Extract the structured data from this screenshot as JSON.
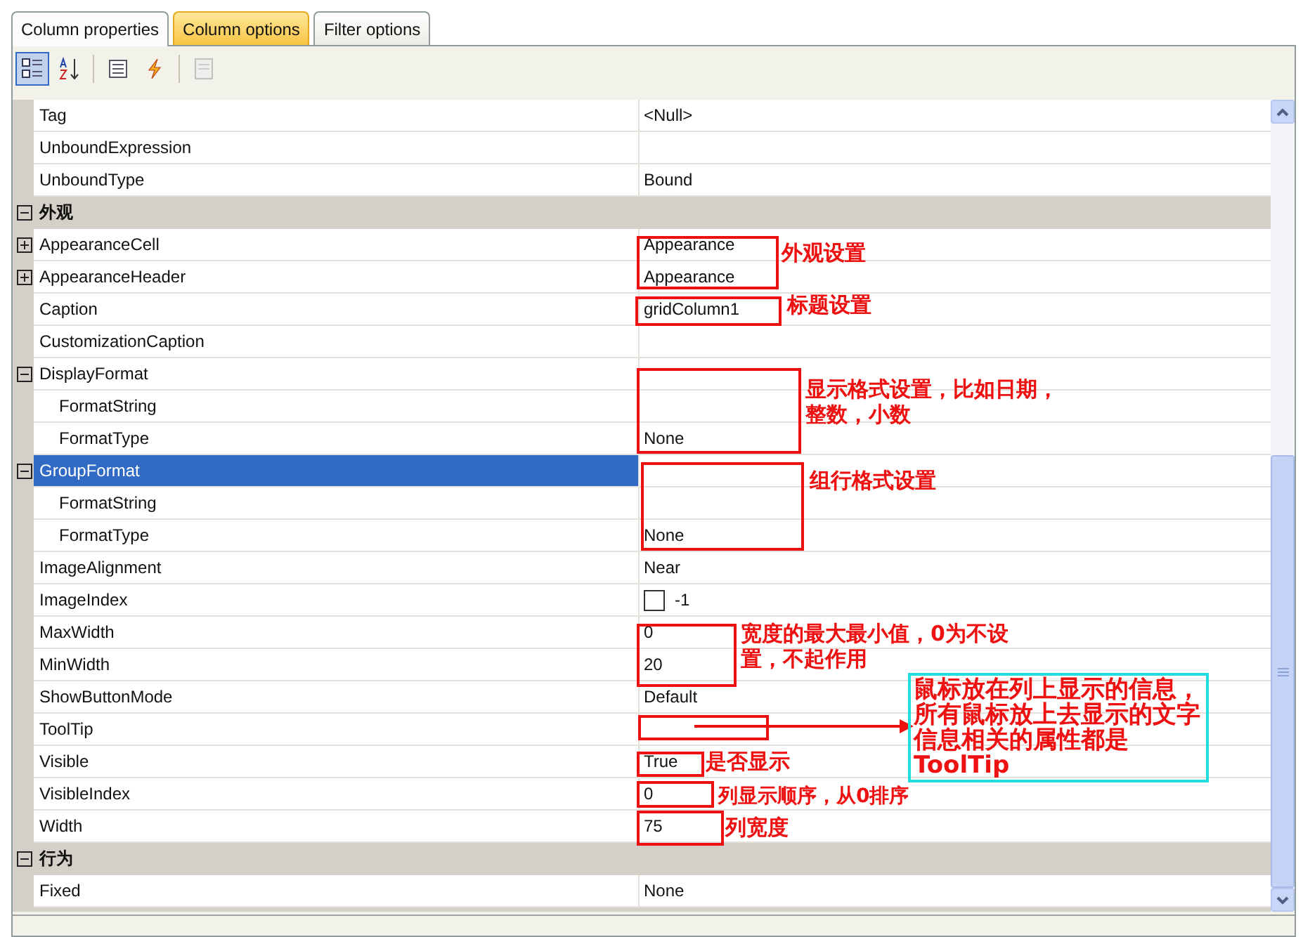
{
  "tabs": [
    {
      "label": "Column properties",
      "selected": true,
      "hot": false
    },
    {
      "label": "Column options",
      "selected": false,
      "hot": true
    },
    {
      "label": "Filter options",
      "selected": false,
      "hot": false
    }
  ],
  "toolbar": [
    {
      "kind": "categorized",
      "selected": true,
      "disabled": false
    },
    {
      "kind": "alphabetical",
      "selected": false,
      "disabled": false
    },
    {
      "kind": "properties",
      "selected": false,
      "disabled": false
    },
    {
      "kind": "events",
      "selected": false,
      "disabled": false
    },
    {
      "kind": "pages",
      "selected": false,
      "disabled": true
    }
  ],
  "rows": [
    {
      "kind": "property",
      "name": "Tag",
      "value": "<Null>",
      "selected": false
    },
    {
      "kind": "property",
      "name": "UnboundExpression",
      "selected": false
    },
    {
      "kind": "property",
      "name": "UnboundType",
      "value": "Bound",
      "selected": false
    },
    {
      "kind": "category",
      "name": "外观",
      "expanded": true,
      "selected": false,
      "children": [
        {
          "kind": "property",
          "name": "AppearanceCell",
          "value": "Appearance",
          "expanded": false,
          "selected": false
        },
        {
          "kind": "property",
          "name": "AppearanceHeader",
          "value": "Appearance",
          "expanded": false,
          "selected": false
        },
        {
          "kind": "property",
          "name": "Caption",
          "value": "gridColumn1",
          "selected": false
        },
        {
          "kind": "property",
          "name": "CustomizationCaption",
          "selected": false
        },
        {
          "kind": "property",
          "name": "DisplayFormat",
          "expanded": true,
          "selected": false,
          "children": [
            {
              "kind": "property",
              "name": "FormatString",
              "selected": false
            },
            {
              "kind": "property",
              "name": "FormatType",
              "value": "None",
              "selected": false
            }
          ]
        },
        {
          "kind": "property",
          "name": "GroupFormat",
          "expanded": true,
          "selected": true,
          "children": [
            {
              "kind": "property",
              "name": "FormatString",
              "selected": false
            },
            {
              "kind": "property",
              "name": "FormatType",
              "value": "None",
              "selected": false
            }
          ]
        },
        {
          "kind": "property",
          "name": "ImageAlignment",
          "value": "Near",
          "selected": false
        },
        {
          "kind": "image",
          "name": "ImageIndex",
          "value": "-1",
          "selected": false
        },
        {
          "kind": "property",
          "name": "MaxWidth",
          "value": "0",
          "selected": false
        },
        {
          "kind": "property",
          "name": "MinWidth",
          "value": "20",
          "selected": false
        },
        {
          "kind": "property",
          "name": "ShowButtonMode",
          "value": "Default",
          "selected": false
        },
        {
          "kind": "property",
          "name": "ToolTip",
          "selected": false
        },
        {
          "kind": "property",
          "name": "Visible",
          "value": "True",
          "selected": false
        },
        {
          "kind": "property",
          "name": "VisibleIndex",
          "value": "0",
          "selected": false
        },
        {
          "kind": "property",
          "name": "Width",
          "value": "75",
          "selected": false
        }
      ]
    },
    {
      "kind": "category",
      "name": "行为",
      "expanded": true,
      "selected": false,
      "children": [
        {
          "kind": "property",
          "name": "Fixed",
          "value": "None",
          "selected": false
        }
      ]
    }
  ],
  "annotations": [
    {
      "kind": "note",
      "text": "外观设置"
    },
    {
      "kind": "note",
      "text": "标题设置"
    },
    {
      "kind": "note",
      "text": "显示格式设置，比如日期，整数，小数"
    },
    {
      "kind": "note",
      "text": "组行格式设置"
    },
    {
      "kind": "note",
      "text": "宽度的最大最小值，0为不设置，不起作用"
    },
    {
      "kind": "note",
      "text": "是否显示"
    },
    {
      "kind": "callout",
      "text": "鼠标放在列上显示的信息，所有鼠标放上去显示的文字信息相关的属性都是ToolTip"
    },
    {
      "kind": "note",
      "text": "列显示顺序，从0排序"
    },
    {
      "kind": "note",
      "text": "列宽度"
    }
  ]
}
